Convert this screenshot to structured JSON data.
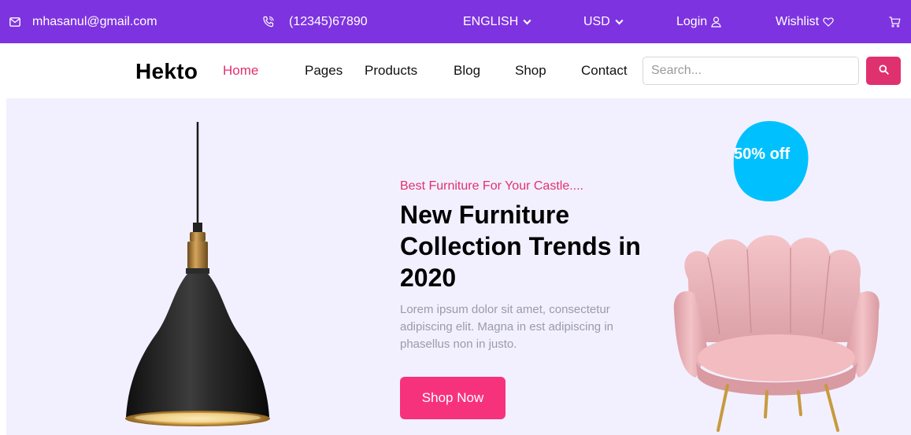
{
  "topbar": {
    "email": "mhasanul@gmail.com",
    "phone": "(12345)67890",
    "language": "ENGLISH",
    "currency": "USD",
    "login": "Login",
    "wishlist": "Wishlist",
    "icons": [
      "mail-icon",
      "phone-icon",
      "chevron-down-icon",
      "user-icon",
      "heart-icon",
      "cart-icon"
    ],
    "background": "#7e33e0"
  },
  "nav": {
    "logo": "Hekto",
    "links": [
      "Home",
      "Pages",
      "Products",
      "Blog",
      "Shop",
      "Contact"
    ],
    "active": "Home",
    "active_color": "#e0316f",
    "search": {
      "placeholder": "Search...",
      "value": ""
    }
  },
  "hero": {
    "subtitle": "Best Furniture For Your Castle....",
    "title": "New Furniture Collection Trends in 2020",
    "description": "Lorem ipsum dolor sit amet, consectetur adipiscing elit. Magna in est adipiscing in phasellus non in justo.",
    "cta": "Shop Now",
    "badge": "50% off",
    "accent": "#f7327d",
    "background": "#f2f0ff",
    "badge_color": "#00c1fe"
  }
}
